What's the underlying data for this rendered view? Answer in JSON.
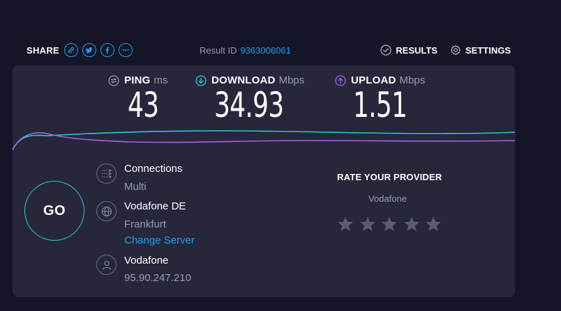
{
  "share": {
    "label": "SHARE",
    "buttons": [
      {
        "icon": "link-icon"
      },
      {
        "icon": "twitter-icon"
      },
      {
        "icon": "facebook-icon"
      },
      {
        "icon": "more-icon"
      }
    ]
  },
  "result": {
    "label": "Result ID",
    "id": "9363006061"
  },
  "nav": {
    "results_label": "RESULTS",
    "settings_label": "SETTINGS"
  },
  "metrics": {
    "ping": {
      "label": "PING",
      "unit": "ms",
      "value": "43"
    },
    "download": {
      "label": "DOWNLOAD",
      "unit": "Mbps",
      "value": "34.93"
    },
    "upload": {
      "label": "UPLOAD",
      "unit": "Mbps",
      "value": "1.51"
    }
  },
  "go_label": "GO",
  "connections": {
    "title": "Connections",
    "value": "Multi"
  },
  "server": {
    "name": "Vodafone DE",
    "location": "Frankfurt",
    "change_label": "Change Server"
  },
  "provider": {
    "name": "Vodafone",
    "ip": "95.90.247.210"
  },
  "rating": {
    "title": "RATE YOUR PROVIDER",
    "provider": "Vodafone",
    "stars_total": 5,
    "stars_selected": 0
  },
  "colors": {
    "background": "#141526",
    "panel": "#26273b",
    "accent_blue": "#1da0f2",
    "download": "#2dc9d6",
    "upload": "#a066e8",
    "muted_text": "#9a9bb0",
    "star": "#5c5d73"
  }
}
